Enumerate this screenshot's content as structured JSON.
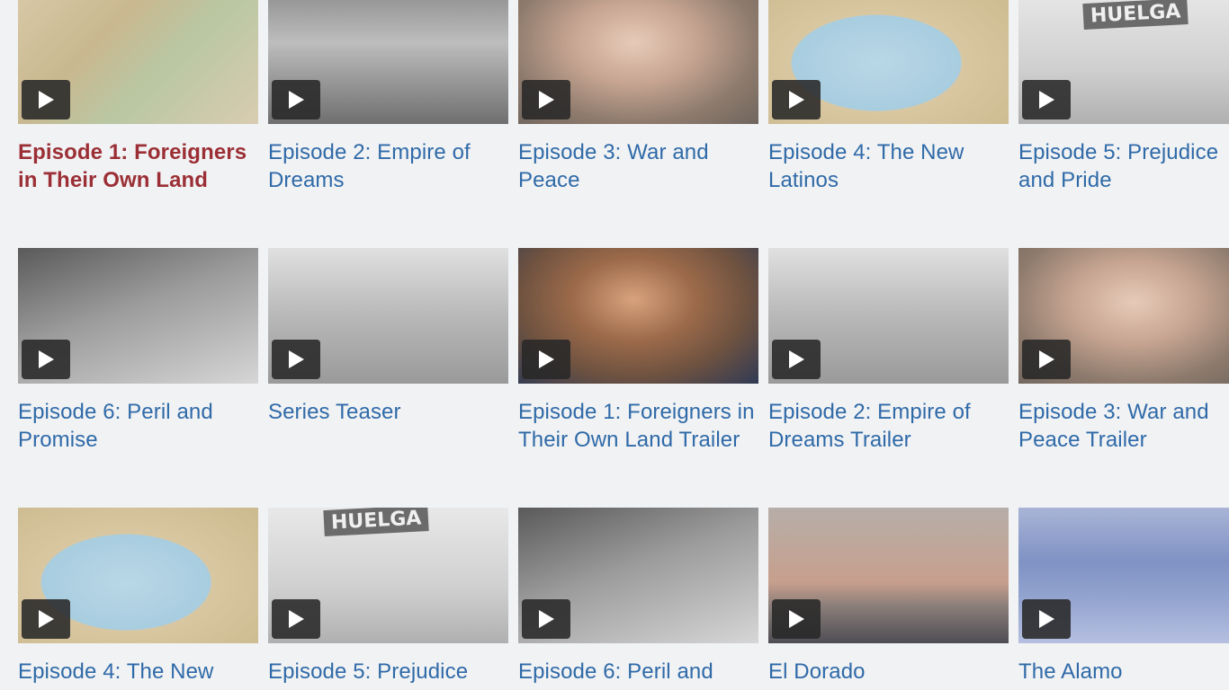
{
  "colors": {
    "link": "#2f6aa8",
    "active_link": "#9b2f35",
    "play_button_bg": "#282828"
  },
  "icons": {
    "play": "play-icon"
  },
  "videos": [
    {
      "title": "Episode 1: Foreigners in Their Own Land",
      "thumb": "map",
      "active": true
    },
    {
      "title": "Episode 2: Empire of Dreams",
      "thumb": "bw1"
    },
    {
      "title": "Episode 3: War and Peace",
      "thumb": "portrait"
    },
    {
      "title": "Episode 4: The New Latinos",
      "thumb": "map-gulf"
    },
    {
      "title": "Episode 5: Prejudice and Pride",
      "thumb": "huelga",
      "sign": "HUELGA"
    },
    {
      "title": "Episode 6: Peril and Promise",
      "thumb": "bw3"
    },
    {
      "title": "Series Teaser",
      "thumb": "bw2"
    },
    {
      "title": "Episode 1: Foreigners in Their Own Land Trailer",
      "thumb": "painting"
    },
    {
      "title": "Episode 2: Empire of Dreams Trailer",
      "thumb": "bw2"
    },
    {
      "title": "Episode 3: War and Peace Trailer",
      "thumb": "portrait"
    },
    {
      "title": "Episode 4: The New",
      "thumb": "map-gulf"
    },
    {
      "title": "Episode 5: Prejudice",
      "thumb": "huelga",
      "sign": "HUELGA"
    },
    {
      "title": "Episode 6: Peril and",
      "thumb": "bw3"
    },
    {
      "title": "El Dorado",
      "thumb": "sunset"
    },
    {
      "title": "The Alamo",
      "thumb": "blue"
    }
  ]
}
